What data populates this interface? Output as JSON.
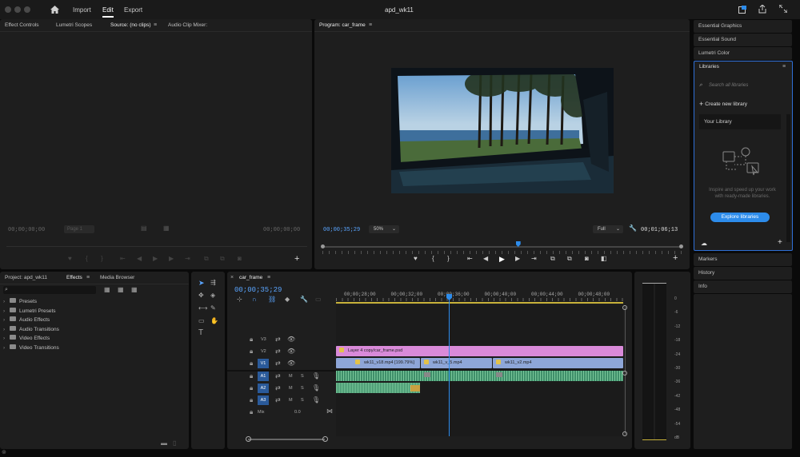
{
  "app": {
    "title": "apd_wk11"
  },
  "menu": {
    "import": "Import",
    "edit": "Edit",
    "export": "Export"
  },
  "source_panel": {
    "tabs": [
      "Effect Controls",
      "Lumetri Scopes",
      "Source: (no clips)",
      "Audio Clip Mixer:"
    ],
    "timecode_left": "00;00;00;00",
    "timecode_right": "00;00;00;00",
    "page": "Page 1"
  },
  "program": {
    "title": "Program: car_frame",
    "timecode": "00;00;35;29",
    "zoom": "50%",
    "quality": "Full",
    "duration": "00;01;06;13",
    "playhead_fraction": 0.545
  },
  "project_panel": {
    "tabs": [
      "Project: apd_wk11",
      "Effects",
      "Media Browser"
    ],
    "items": [
      "Presets",
      "Lumetri Presets",
      "Audio Effects",
      "Audio Transitions",
      "Video Effects",
      "Video Transitions"
    ]
  },
  "timeline": {
    "sequence": "car_frame",
    "timecode": "00;00;35;29",
    "ruler": [
      "00;00;28;00",
      "00;00;32;00",
      "00;00;36;00",
      "00;00;40;00",
      "00;00;44;00",
      "00;00;48;00"
    ],
    "tracks": {
      "v3": "V3",
      "v2": "V2",
      "v1": "V1",
      "a1": "A1",
      "a2": "A2",
      "a3": "A3",
      "mix": "Mix",
      "mix_value": "0.0",
      "m": "M",
      "s": "S"
    },
    "clips": {
      "psd": "Layer 4 copy/car_frame.psd",
      "v1a": "wk11_v18.mp4 [199.79%]",
      "v1b": "wk11_v_5.mp4",
      "v1c": "wk11_v2.mp4"
    }
  },
  "meter": {
    "scale": [
      "0",
      "-6",
      "-12",
      "-18",
      "-24",
      "-30",
      "-36",
      "-42",
      "-48",
      "-54",
      "dB"
    ]
  },
  "right_panels": {
    "essential_graphics": "Essential Graphics",
    "essential_sound": "Essential Sound",
    "lumetri_color": "Lumetri Color",
    "libraries": "Libraries",
    "search_placeholder": "Search all libraries",
    "create_new": "Create new library",
    "your_library": "Your Library",
    "inspire_text": "Inspire and speed up your work with ready-made libraries.",
    "explore": "Explore libraries",
    "markers": "Markers",
    "history": "History",
    "info": "Info"
  },
  "colors": {
    "accent": "#2d8ceb",
    "timecode": "#5aa5ff",
    "v2clip": "#d98ad9",
    "v1clip": "#8ea6d8",
    "aclip": "#3f8f6a",
    "libraries_border": "#2f6fd6"
  }
}
